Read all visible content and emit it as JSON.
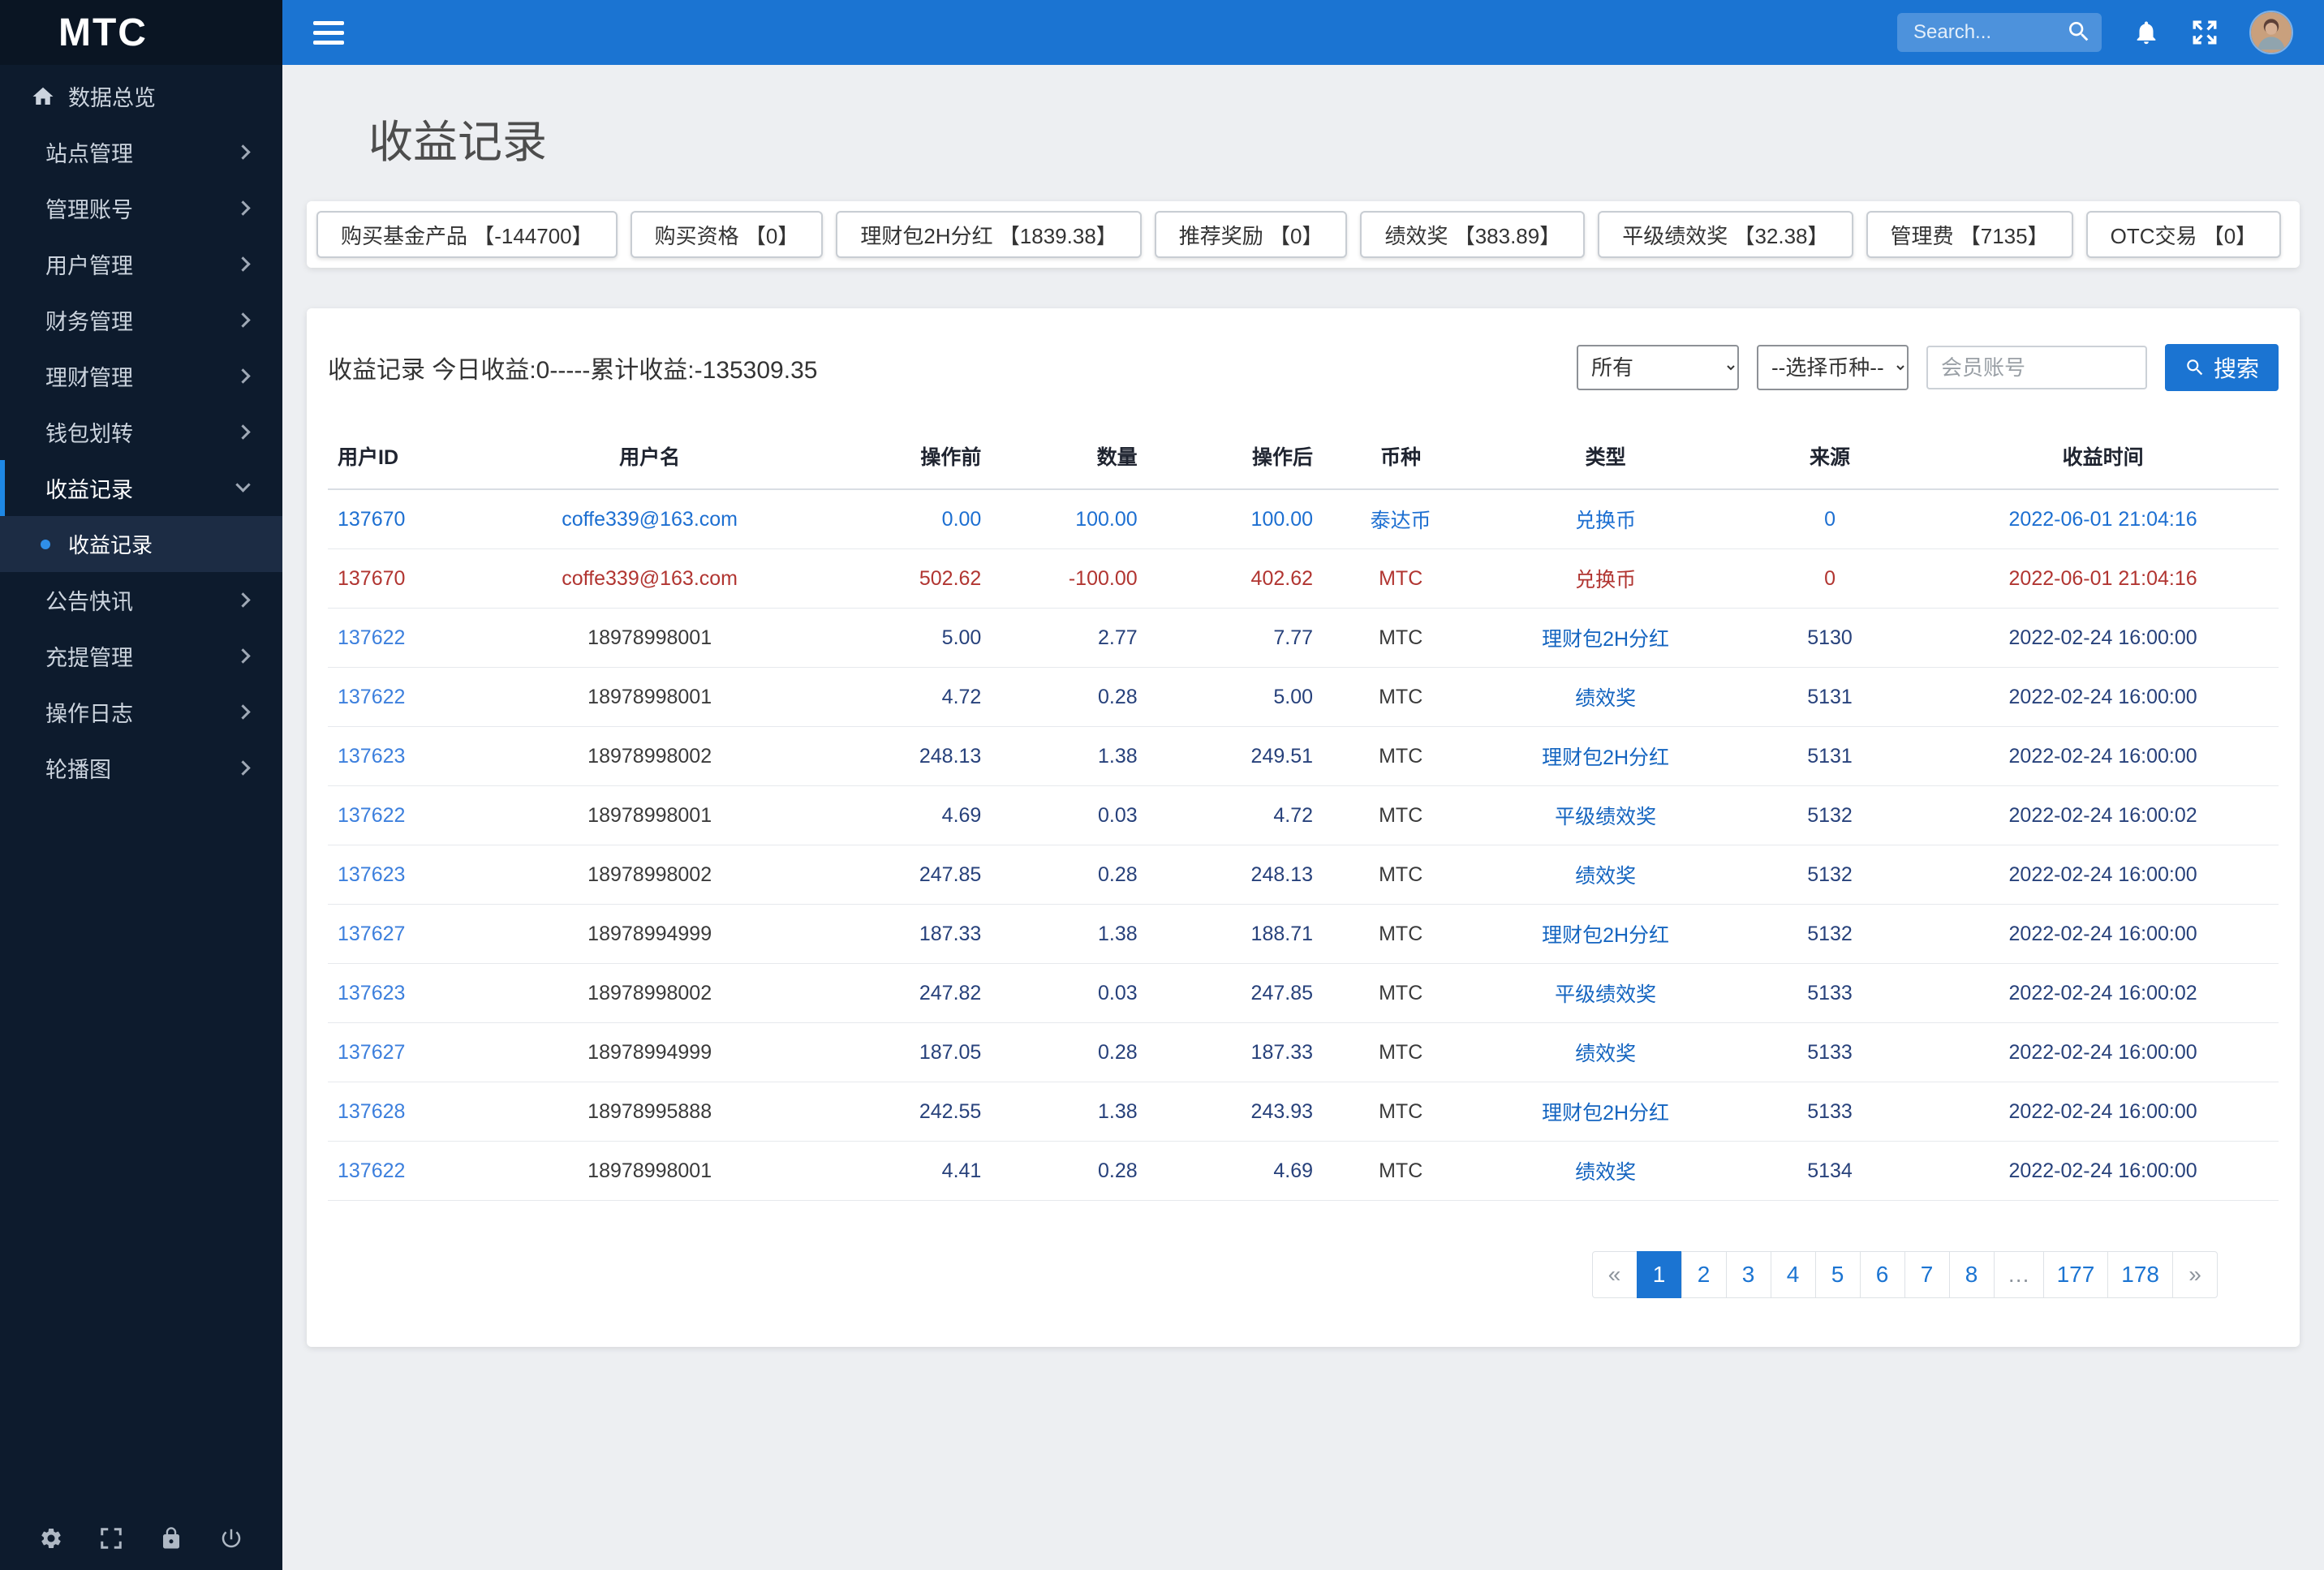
{
  "topbar": {
    "brand": "MTC",
    "search_placeholder": "Search..."
  },
  "icons": {
    "hamburger-menu-icon": "three-bars",
    "search-icon": "magnifier",
    "bell-icon": "bell",
    "fullscreen-icon": "expand-arrows",
    "home-icon": "house",
    "chevron-right-icon": "chevron-right",
    "chevron-down-icon": "chevron-down",
    "bullet-dot-icon": "dot",
    "gear-icon": "cog",
    "lock-icon": "padlock",
    "power-icon": "power"
  },
  "sidebar": {
    "items": [
      {
        "label": "数据总览"
      },
      {
        "label": "站点管理"
      },
      {
        "label": "管理账号"
      },
      {
        "label": "用户管理"
      },
      {
        "label": "财务管理"
      },
      {
        "label": "理财管理"
      },
      {
        "label": "钱包划转"
      },
      {
        "label": "收益记录"
      },
      {
        "label": "公告快讯"
      },
      {
        "label": "充提管理"
      },
      {
        "label": "操作日志"
      },
      {
        "label": "轮播图"
      }
    ],
    "submenu": {
      "label": "收益记录"
    }
  },
  "page": {
    "title": "收益记录",
    "stats": [
      "购买基金产品 【-144700】",
      "购买资格 【0】",
      "理财包2H分红 【1839.38】",
      "推荐奖励 【0】",
      "绩效奖 【383.89】",
      "平级绩效奖 【32.38】",
      "管理费 【7135】",
      "OTC交易 【0】"
    ],
    "summary": "收益记录 今日收益:0-----累计收益:-135309.35",
    "filters": {
      "type_select": "所有",
      "coin_select": "--选择币种--",
      "account_placeholder": "会员账号",
      "search_button": "搜索"
    },
    "table": {
      "headers": [
        "用户ID",
        "用户名",
        "操作前",
        "数量",
        "操作后",
        "币种",
        "类型",
        "来源",
        "收益时间"
      ],
      "rows": [
        {
          "tone": "blue",
          "cells": [
            "137670",
            "coffe339@163.com",
            "0.00",
            "100.00",
            "100.00",
            "泰达币",
            "兑换币",
            "0",
            "2022-06-01 21:04:16"
          ]
        },
        {
          "tone": "red",
          "cells": [
            "137670",
            "coffe339@163.com",
            "502.62",
            "-100.00",
            "402.62",
            "MTC",
            "兑换币",
            "0",
            "2022-06-01 21:04:16"
          ]
        },
        {
          "tone": "normal",
          "cells": [
            "137622",
            "18978998001",
            "5.00",
            "2.77",
            "7.77",
            "MTC",
            "理财包2H分红",
            "5130",
            "2022-02-24 16:00:00"
          ]
        },
        {
          "tone": "normal",
          "cells": [
            "137622",
            "18978998001",
            "4.72",
            "0.28",
            "5.00",
            "MTC",
            "绩效奖",
            "5131",
            "2022-02-24 16:00:00"
          ]
        },
        {
          "tone": "normal",
          "cells": [
            "137623",
            "18978998002",
            "248.13",
            "1.38",
            "249.51",
            "MTC",
            "理财包2H分红",
            "5131",
            "2022-02-24 16:00:00"
          ]
        },
        {
          "tone": "normal",
          "cells": [
            "137622",
            "18978998001",
            "4.69",
            "0.03",
            "4.72",
            "MTC",
            "平级绩效奖",
            "5132",
            "2022-02-24 16:00:02"
          ]
        },
        {
          "tone": "normal",
          "cells": [
            "137623",
            "18978998002",
            "247.85",
            "0.28",
            "248.13",
            "MTC",
            "绩效奖",
            "5132",
            "2022-02-24 16:00:00"
          ]
        },
        {
          "tone": "normal",
          "cells": [
            "137627",
            "18978994999",
            "187.33",
            "1.38",
            "188.71",
            "MTC",
            "理财包2H分红",
            "5132",
            "2022-02-24 16:00:00"
          ]
        },
        {
          "tone": "normal",
          "cells": [
            "137623",
            "18978998002",
            "247.82",
            "0.03",
            "247.85",
            "MTC",
            "平级绩效奖",
            "5133",
            "2022-02-24 16:00:02"
          ]
        },
        {
          "tone": "normal",
          "cells": [
            "137627",
            "18978994999",
            "187.05",
            "0.28",
            "187.33",
            "MTC",
            "绩效奖",
            "5133",
            "2022-02-24 16:00:00"
          ]
        },
        {
          "tone": "normal",
          "cells": [
            "137628",
            "18978995888",
            "242.55",
            "1.38",
            "243.93",
            "MTC",
            "理财包2H分红",
            "5133",
            "2022-02-24 16:00:00"
          ]
        },
        {
          "tone": "normal",
          "cells": [
            "137622",
            "18978998001",
            "4.41",
            "0.28",
            "4.69",
            "MTC",
            "绩效奖",
            "5134",
            "2022-02-24 16:00:00"
          ]
        }
      ]
    },
    "pagination": {
      "items": [
        "«",
        "1",
        "2",
        "3",
        "4",
        "5",
        "6",
        "7",
        "8",
        "…",
        "177",
        "178",
        "»"
      ],
      "active": "1"
    }
  },
  "colors": {
    "topbar_blue": "#1b74d2",
    "sidebar_navy": "#0d1b2d",
    "row_blue": "#1d6fd1",
    "row_red": "#b13531",
    "accent_blue": "#1e88e5"
  }
}
